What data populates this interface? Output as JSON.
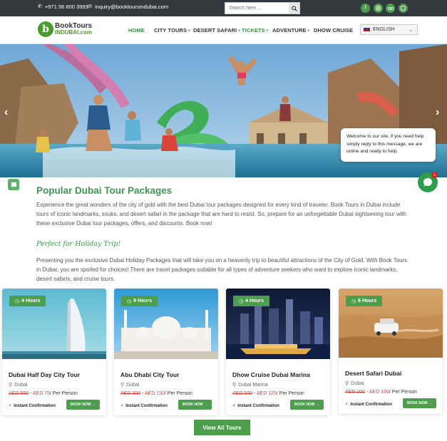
{
  "topbar": {
    "phone": "+971 56 800 3993",
    "email": "inquiry@booktoursindubai.com",
    "search_placeholder": "Search here ...",
    "social_icons": [
      "facebook-icon",
      "instagram-icon",
      "tripadvisor-icon",
      "whatsapp-icon"
    ]
  },
  "nav": {
    "logo_line1": "BookTours",
    "logo_line2": "INDUBAI.com",
    "logo_mark": "b",
    "menu": [
      {
        "label": "HOME",
        "plus": ""
      },
      {
        "label": "CITY TOURS",
        "plus": "+"
      },
      {
        "label": "DESERT SAFARI",
        "plus": "+"
      },
      {
        "label": "TICKETS",
        "plus": "+"
      },
      {
        "label": "ADVENTURE",
        "plus": "+"
      },
      {
        "label": "DHOW CRUISE",
        "plus": ""
      }
    ],
    "language": "ENGLISH"
  },
  "chat": {
    "message": "Welcome to our site, if you need help simply reply to this message, we are online and ready to help.",
    "badge": "1"
  },
  "content": {
    "heading": "Popular Dubai Tour Packages",
    "intro": "Experience the great wonders of the city of gold with the best Dubai tour packages designed for every kind of traveler. Book Tours in Dubai include tours of iconic landmarks, souks, and desert safari in the package that are hard to resist. So, prepare for an unforgettable Dubai sightseeing tour with these exclusive Dubai tour packages, offers, and discounts. Book now!",
    "subheading": "Perfect for Holiday Trip!",
    "intro2": "Presenting you the exclusive Dubai Holiday Packages that will take you on a heavenly trip to beautiful attractions of the City of Gold. With Book Tours in Dubai, you are spoiled for choices! There are travel packages suitable for all types of adventure seekers who want to explore iconic landmarks, desert safaris, and cruise tours."
  },
  "cards": [
    {
      "hours": "4 Hours",
      "title": "Dubai Half Day City Tour",
      "location": "Dubai",
      "old_price": "AED 550",
      "new_price": "AED 75",
      "per": "/ Per Person",
      "instant": "Instant Confirmation",
      "book": "BOOK NOW"
    },
    {
      "hours": "9 Hours",
      "title": "Abu Dhabi City Tour",
      "location": "Dubai",
      "old_price": "AED 300",
      "new_price": "AED 150",
      "per": "/ Per Person",
      "instant": "Instant Confirmation",
      "book": "BOOK NOW"
    },
    {
      "hours": "4 Hours",
      "title": "Dhow Cruise Dubai Marina",
      "location": "Dubai Marina",
      "old_price": "AED 500",
      "new_price": "AED 125",
      "per": "/ Per Person",
      "instant": "Instant Confirmation",
      "book": "BOOK NOW"
    },
    {
      "hours": "6 Hours",
      "title": "Desert Safari Dubai",
      "location": "Dubai",
      "old_price": "AED 200",
      "new_price": "AED 150",
      "per": "/ Per Person",
      "instant": "Instant Confirmation",
      "book": "BOOK NOW"
    }
  ],
  "view_all": "View All Tours",
  "colors": {
    "brand_green": "#4c9d4c",
    "heading_green": "#3c9a50",
    "topbar": "#333a3d",
    "price_red": "#e0403a"
  }
}
